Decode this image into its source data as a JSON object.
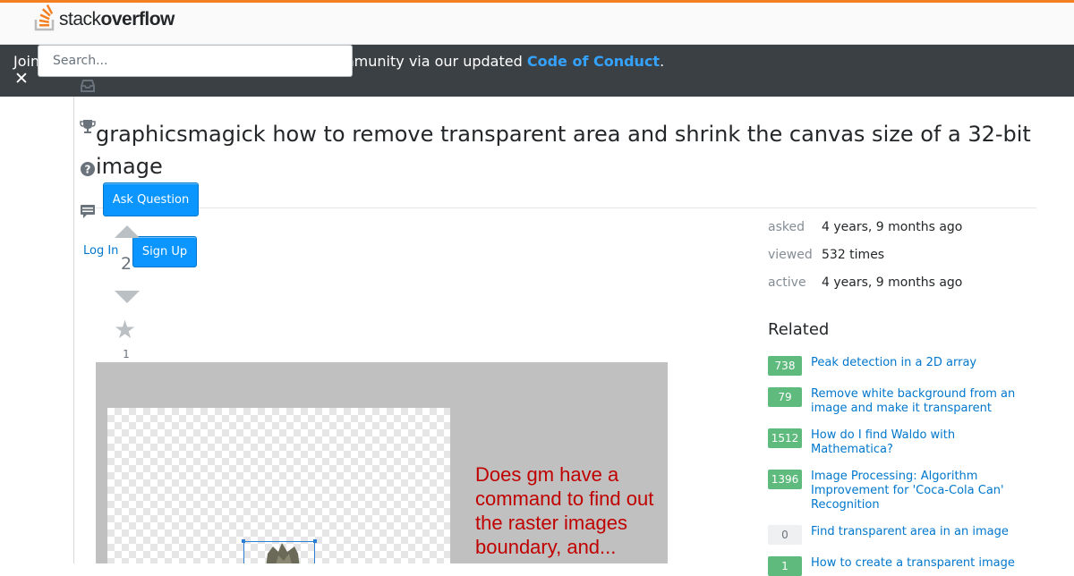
{
  "header": {
    "logo_text_light": "stack",
    "logo_text_bold": "overflow",
    "search_placeholder": "Search..."
  },
  "banner": {
    "text_prefix": "Join",
    "text_middle": "mmunity via our updated ",
    "link_text": "Code of Conduct",
    "text_suffix": ".",
    "close_label": "✕"
  },
  "sidebar": {
    "icons": [
      "inbox-icon",
      "trophy-icon",
      "help-icon",
      "chat-icon"
    ],
    "ask_question": "Ask Question",
    "log_in": "Log In",
    "sign_up": "Sign Up"
  },
  "question": {
    "title": "graphicsmagick how to remove transparent area and shrink the canvas size of a 32-bit image",
    "votes": "2",
    "favorites": "1",
    "image_caption": "Does gm have a command to find out the raster images boundary, and..."
  },
  "stats": [
    {
      "label": "asked",
      "value": "4 years, 9 months ago"
    },
    {
      "label": "viewed",
      "value": "532 times"
    },
    {
      "label": "active",
      "value": "4 years, 9 months ago"
    }
  ],
  "related": {
    "title": "Related",
    "items": [
      {
        "score": "738",
        "text": "Peak detection in a 2D array",
        "answered": true
      },
      {
        "score": "79",
        "text": "Remove white background from an image and make it transparent",
        "answered": true
      },
      {
        "score": "1512",
        "text": "How do I find Waldo with Mathematica?",
        "answered": true
      },
      {
        "score": "1396",
        "text": "Image Processing: Algorithm Improvement for 'Coca-Cola Can' Recognition",
        "answered": true
      },
      {
        "score": "0",
        "text": "Find transparent area in an image",
        "answered": false
      },
      {
        "score": "1",
        "text": "How to create a transparent image",
        "answered": true
      }
    ]
  },
  "colors": {
    "accent": "#f48024",
    "banner_bg": "#3b4045",
    "link": "#0077cc",
    "button": "#0a95ff",
    "answered_badge": "#5eba7d"
  }
}
